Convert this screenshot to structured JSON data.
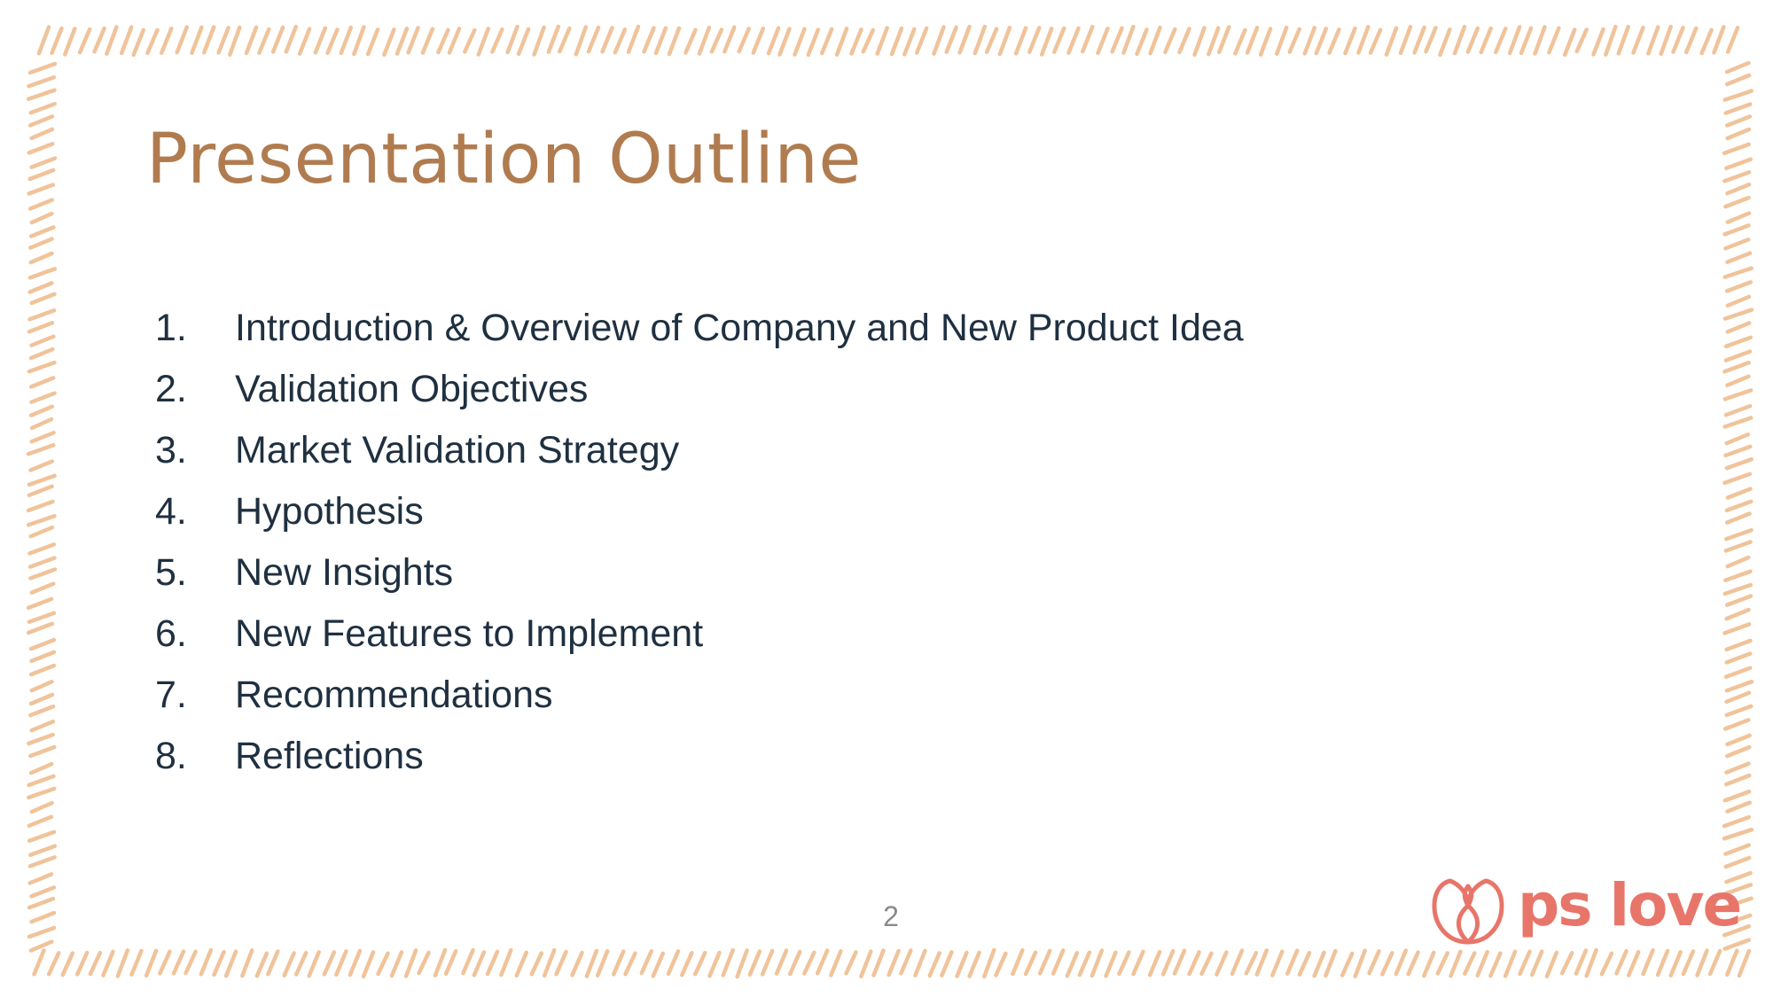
{
  "slide": {
    "title": "Presentation Outline",
    "items": [
      {
        "number": "1.",
        "text": "Introduction & Overview of Company and New Product Idea"
      },
      {
        "number": "2.",
        "text": "Validation Objectives"
      },
      {
        "number": "3.",
        "text": "Market Validation Strategy"
      },
      {
        "number": "4.",
        "text": "Hypothesis"
      },
      {
        "number": "5.",
        "text": "New Insights"
      },
      {
        "number": "6.",
        "text": "New Features to Implement"
      },
      {
        "number": "7.",
        "text": "Recommendations"
      },
      {
        "number": "8.",
        "text": "Reflections"
      }
    ],
    "page_number": "2",
    "logo_text": "ps love"
  },
  "colors": {
    "title": "#b07c4f",
    "body_text": "#1f3040",
    "page_number": "#8a8a8a",
    "border_stroke": "#f0c39a",
    "logo": "#e8756a",
    "background": "#ffffff"
  }
}
